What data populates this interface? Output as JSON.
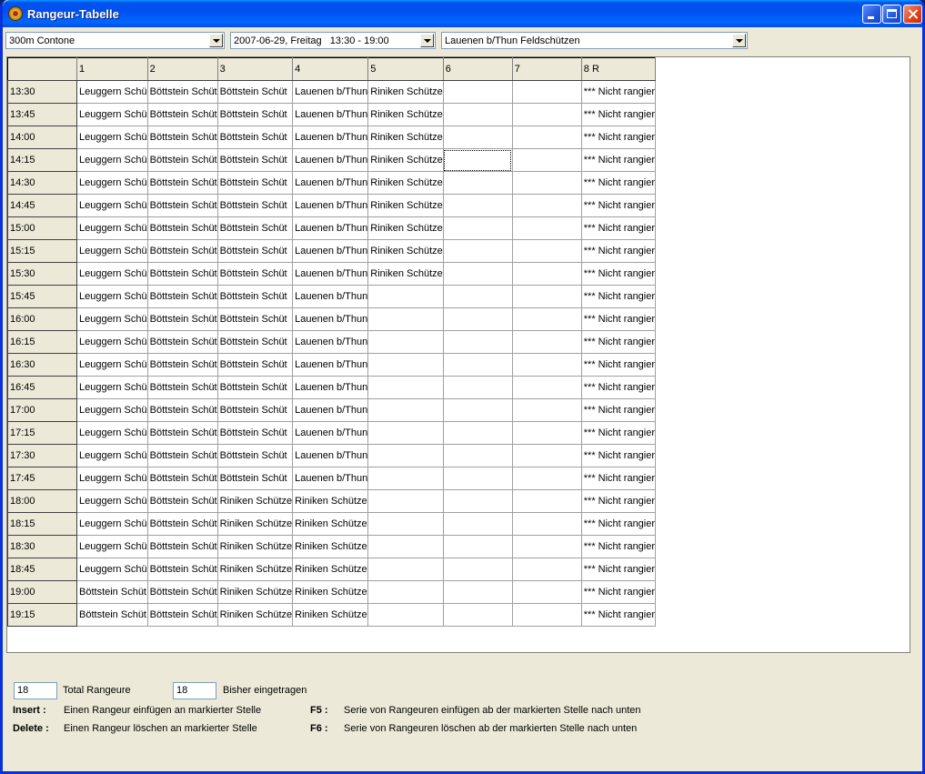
{
  "window": {
    "title": "Rangeur-Tabelle"
  },
  "filters": {
    "distance": "300m Contone",
    "date": "2007-06-29, Freitag   13:30 - 19:00",
    "club": "Lauenen b/Thun Feldschützen"
  },
  "grid": {
    "columns": [
      "",
      "1",
      "2",
      "3",
      "4",
      "5",
      "6",
      "7",
      "8  R"
    ],
    "rows": [
      {
        "time": "13:30",
        "cells": [
          "Leuggern Schü",
          "Böttstein Schüt",
          "Böttstein Schüt",
          "Lauenen b/Thun",
          "Riniken Schütze",
          "",
          "",
          "*** Nicht rangier"
        ]
      },
      {
        "time": "13:45",
        "cells": [
          "Leuggern Schü",
          "Böttstein Schüt",
          "Böttstein Schüt",
          "Lauenen b/Thun",
          "Riniken Schütze",
          "",
          "",
          "*** Nicht rangier"
        ]
      },
      {
        "time": "14:00",
        "cells": [
          "Leuggern Schü",
          "Böttstein Schüt",
          "Böttstein Schüt",
          "Lauenen b/Thun",
          "Riniken Schütze",
          "",
          "",
          "*** Nicht rangier"
        ]
      },
      {
        "time": "14:15",
        "cells": [
          "Leuggern Schü",
          "Böttstein Schüt",
          "Böttstein Schüt",
          "Lauenen b/Thun",
          "Riniken Schütze",
          "",
          "",
          "*** Nicht rangier"
        ]
      },
      {
        "time": "14:30",
        "cells": [
          "Leuggern Schü",
          "Böttstein Schüt",
          "Böttstein Schüt",
          "Lauenen b/Thun",
          "Riniken Schütze",
          "",
          "",
          "*** Nicht rangier"
        ]
      },
      {
        "time": "14:45",
        "cells": [
          "Leuggern Schü",
          "Böttstein Schüt",
          "Böttstein Schüt",
          "Lauenen b/Thun",
          "Riniken Schütze",
          "",
          "",
          "*** Nicht rangier"
        ]
      },
      {
        "time": "15:00",
        "cells": [
          "Leuggern Schü",
          "Böttstein Schüt",
          "Böttstein Schüt",
          "Lauenen b/Thun",
          "Riniken Schütze",
          "",
          "",
          "*** Nicht rangier"
        ]
      },
      {
        "time": "15:15",
        "cells": [
          "Leuggern Schü",
          "Böttstein Schüt",
          "Böttstein Schüt",
          "Lauenen b/Thun",
          "Riniken Schütze",
          "",
          "",
          "*** Nicht rangier"
        ]
      },
      {
        "time": "15:30",
        "cells": [
          "Leuggern Schü",
          "Böttstein Schüt",
          "Böttstein Schüt",
          "Lauenen b/Thun",
          "Riniken Schütze",
          "",
          "",
          "*** Nicht rangier"
        ]
      },
      {
        "time": "15:45",
        "cells": [
          "Leuggern Schü",
          "Böttstein Schüt",
          "Böttstein Schüt",
          "Lauenen b/Thun",
          "",
          "",
          "",
          "*** Nicht rangier"
        ]
      },
      {
        "time": "16:00",
        "cells": [
          "Leuggern Schü",
          "Böttstein Schüt",
          "Böttstein Schüt",
          "Lauenen b/Thun",
          "",
          "",
          "",
          "*** Nicht rangier"
        ]
      },
      {
        "time": "16:15",
        "cells": [
          "Leuggern Schü",
          "Böttstein Schüt",
          "Böttstein Schüt",
          "Lauenen b/Thun",
          "",
          "",
          "",
          "*** Nicht rangier"
        ]
      },
      {
        "time": "16:30",
        "cells": [
          "Leuggern Schü",
          "Böttstein Schüt",
          "Böttstein Schüt",
          "Lauenen b/Thun",
          "",
          "",
          "",
          "*** Nicht rangier"
        ]
      },
      {
        "time": "16:45",
        "cells": [
          "Leuggern Schü",
          "Böttstein Schüt",
          "Böttstein Schüt",
          "Lauenen b/Thun",
          "",
          "",
          "",
          "*** Nicht rangier"
        ]
      },
      {
        "time": "17:00",
        "cells": [
          "Leuggern Schü",
          "Böttstein Schüt",
          "Böttstein Schüt",
          "Lauenen b/Thun",
          "",
          "",
          "",
          "*** Nicht rangier"
        ]
      },
      {
        "time": "17:15",
        "cells": [
          "Leuggern Schü",
          "Böttstein Schüt",
          "Böttstein Schüt",
          "Lauenen b/Thun",
          "",
          "",
          "",
          "*** Nicht rangier"
        ]
      },
      {
        "time": "17:30",
        "cells": [
          "Leuggern Schü",
          "Böttstein Schüt",
          "Böttstein Schüt",
          "Lauenen b/Thun",
          "",
          "",
          "",
          "*** Nicht rangier"
        ]
      },
      {
        "time": "17:45",
        "cells": [
          "Leuggern Schü",
          "Böttstein Schüt",
          "Böttstein Schüt",
          "Lauenen b/Thun",
          "",
          "",
          "",
          "*** Nicht rangier"
        ]
      },
      {
        "time": "18:00",
        "cells": [
          "Leuggern Schü",
          "Böttstein Schüt",
          "Riniken Schütze",
          "Riniken Schütze",
          "",
          "",
          "",
          "*** Nicht rangier"
        ]
      },
      {
        "time": "18:15",
        "cells": [
          "Leuggern Schü",
          "Böttstein Schüt",
          "Riniken Schütze",
          "Riniken Schütze",
          "",
          "",
          "",
          "*** Nicht rangier"
        ]
      },
      {
        "time": "18:30",
        "cells": [
          "Leuggern Schü",
          "Böttstein Schüt",
          "Riniken Schütze",
          "Riniken Schütze",
          "",
          "",
          "",
          "*** Nicht rangier"
        ]
      },
      {
        "time": "18:45",
        "cells": [
          "Leuggern Schü",
          "Böttstein Schüt",
          "Riniken Schütze",
          "Riniken Schütze",
          "",
          "",
          "",
          "*** Nicht rangier"
        ]
      },
      {
        "time": "19:00",
        "cells": [
          "Böttstein Schüt",
          "Böttstein Schüt",
          "Riniken Schütze",
          "Riniken Schütze",
          "",
          "",
          "",
          "*** Nicht rangier"
        ]
      },
      {
        "time": "19:15",
        "cells": [
          "Böttstein Schüt",
          "Böttstein Schüt",
          "Riniken Schütze",
          "Riniken Schütze",
          "",
          "",
          "",
          "*** Nicht rangier"
        ]
      }
    ]
  },
  "footer": {
    "total_value": "18",
    "total_label": "Total Rangeure",
    "registered_value": "18",
    "registered_label": "Bisher eingetragen",
    "insert_key": "Insert :",
    "insert_desc": "Einen Rangeur einfügen an markierter Stelle",
    "delete_key": "Delete :",
    "delete_desc": "Einen Rangeur löschen an markierter Stelle",
    "f5_key": "F5 :",
    "f5_desc": "Serie von Rangeuren einfügen ab der markierten Stelle nach unten",
    "f6_key": "F6 :",
    "f6_desc": "Serie von Rangeuren löschen ab der markierten Stelle nach unten"
  }
}
